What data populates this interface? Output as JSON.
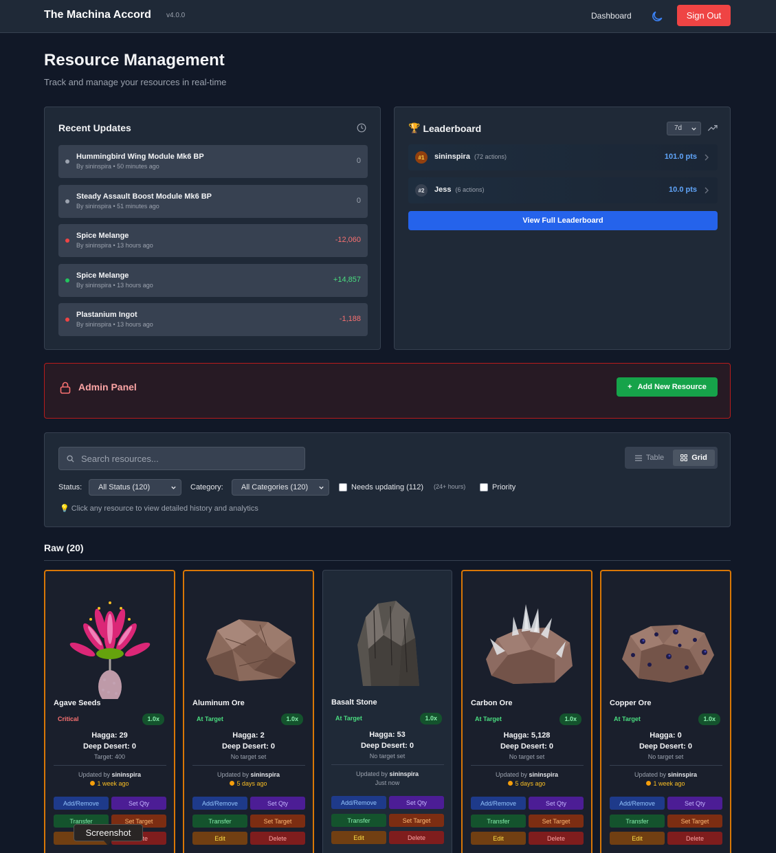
{
  "nav": {
    "brand": "The Machina Accord",
    "version": "v4.0.0",
    "dashboard": "Dashboard",
    "sign_out": "Sign Out",
    "theme_icon": "moon-icon"
  },
  "header": {
    "title": "Resource Management",
    "subtitle": "Track and manage your resources in real-time"
  },
  "recent": {
    "title": "Recent Updates",
    "items": [
      {
        "name": "Hummingbird Wing Module Mk6 BP",
        "by": "By sininspira • 50 minutes ago",
        "value": "0",
        "tone": "neutral"
      },
      {
        "name": "Steady Assault Boost Module Mk6 BP",
        "by": "By sininspira • 51 minutes ago",
        "value": "0",
        "tone": "neutral"
      },
      {
        "name": "Spice Melange",
        "by": "By sininspira • 13 hours ago",
        "value": "-12,060",
        "tone": "negative"
      },
      {
        "name": "Spice Melange",
        "by": "By sininspira • 13 hours ago",
        "value": "+14,857",
        "tone": "positive"
      },
      {
        "name": "Plastanium Ingot",
        "by": "By sininspira • 13 hours ago",
        "value": "-1,188",
        "tone": "negative"
      }
    ]
  },
  "leaderboard": {
    "title": "Leaderboard",
    "period": "7d",
    "rows": [
      {
        "rank": "#1",
        "name": "sininspira",
        "actions": "(72 actions)",
        "points": "101.0 pts"
      },
      {
        "rank": "#2",
        "name": "Jess",
        "actions": "(6 actions)",
        "points": "10.0 pts"
      }
    ],
    "view_full": "View Full Leaderboard"
  },
  "admin": {
    "title": "Admin Panel",
    "add_button": "Add New Resource"
  },
  "filters": {
    "search_placeholder": "Search resources...",
    "view_table": "Table",
    "view_grid": "Grid",
    "status_label": "Status:",
    "status_value": "All Status (120)",
    "category_label": "Category:",
    "category_value": "All Categories (120)",
    "needs_updating": "Needs updating (112)",
    "needs_updating_hint": "(24+ hours)",
    "priority": "Priority",
    "tip": "💡 Click any resource to view detailed history and analytics"
  },
  "section": {
    "title": "Raw (20)"
  },
  "cards": [
    {
      "name": "Agave Seeds",
      "status": "Critical",
      "status_color": "#f87171",
      "mult": "1.0x",
      "hagga": "Hagga: 29",
      "deep": "Deep Desert: 0",
      "target": "Target: 400",
      "updated_prefix": "Updated by ",
      "updated_by": "sininspira",
      "ago": "1 week ago",
      "ago_color": "#fbbf24",
      "image": "agave-plant"
    },
    {
      "name": "Aluminum Ore",
      "status": "At Target",
      "status_color": "#4ade80",
      "mult": "1.0x",
      "hagga": "Hagga: 2",
      "deep": "Deep Desert: 0",
      "target": "No target set",
      "updated_prefix": "Updated by ",
      "updated_by": "sininspira",
      "ago": "5 days ago",
      "ago_color": "#fbbf24",
      "image": "aluminum-rock"
    },
    {
      "name": "Basalt Stone",
      "status": "At Target",
      "status_color": "#4ade80",
      "mult": "1.0x",
      "hagga": "Hagga: 53",
      "deep": "Deep Desert: 0",
      "target": "No target set",
      "updated_prefix": "Updated by ",
      "updated_by": "sininspira",
      "ago": "Just now",
      "ago_color": "#9ca3af",
      "image": "basalt-rock"
    },
    {
      "name": "Carbon Ore",
      "status": "At Target",
      "status_color": "#4ade80",
      "mult": "1.0x",
      "hagga": "Hagga: 5,128",
      "deep": "Deep Desert: 0",
      "target": "No target set",
      "updated_prefix": "Updated by ",
      "updated_by": "sininspira",
      "ago": "5 days ago",
      "ago_color": "#fbbf24",
      "image": "carbon-crystal-rock"
    },
    {
      "name": "Copper Ore",
      "status": "At Target",
      "status_color": "#4ade80",
      "mult": "1.0x",
      "hagga": "Hagga: 0",
      "deep": "Deep Desert: 0",
      "target": "No target set",
      "updated_prefix": "Updated by ",
      "updated_by": "sininspira",
      "ago": "1 week ago",
      "ago_color": "#fbbf24",
      "image": "copper-rock"
    }
  ],
  "card_buttons": {
    "add_remove": "Add/Remove",
    "set_qty": "Set Qty",
    "transfer": "Transfer",
    "set_target": "Set Target",
    "edit": "Edit",
    "delete": "Delete"
  },
  "tooltip": "Screenshot",
  "colors": {
    "accent": "#2563eb",
    "danger": "#ef4444",
    "success": "#16a34a",
    "card_border": "#d97706"
  }
}
